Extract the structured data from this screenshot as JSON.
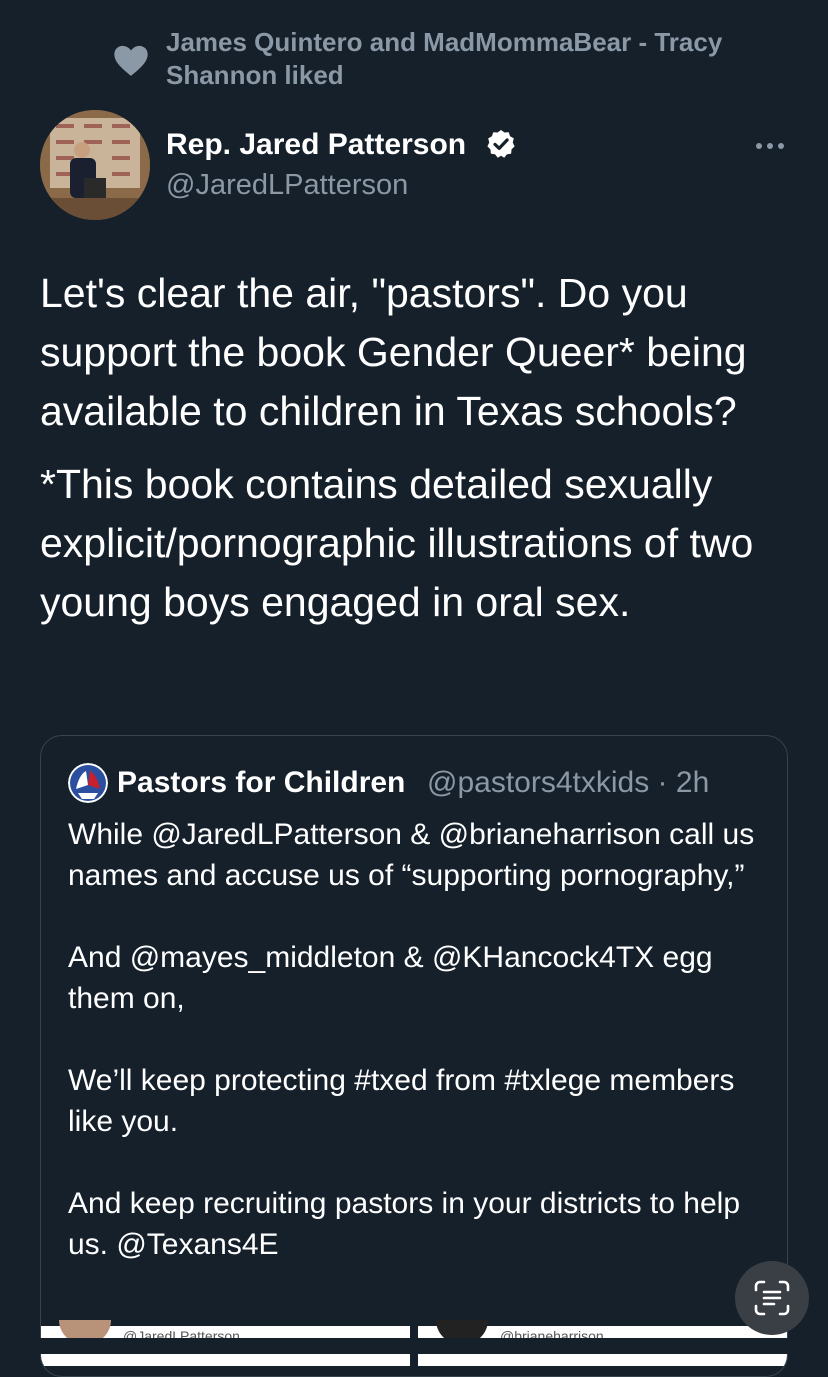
{
  "social_context": {
    "icon": "heart-icon",
    "text": "James Quintero and MadMommaBear - Tracy Shannon liked"
  },
  "tweet": {
    "author_name": "Rep. Jared Patterson",
    "author_handle": "@JaredLPatterson",
    "verified": true,
    "paragraphs": [
      "Let's clear the air, \"pastors\". Do you support the book Gender Queer* being available to children in Texas schools?",
      "*This book contains detailed sexually explicit/pornographic illustrations of two young boys engaged in oral sex."
    ]
  },
  "quote": {
    "author_name": "Pastors for Children",
    "author_handle": "@pastors4txkids",
    "separator": "·",
    "time": "2h",
    "paragraphs": [
      "While @JaredLPatterson & @brianeharrison call us names and accuse us of “supporting pornography,”",
      "And @mayes_middleton & @KHancock4TX egg them on,",
      "We’ll keep protecting #txed from  #txlege members like you.",
      "And keep recruiting pastors in your districts to help us. @Texans4E"
    ],
    "images": [
      {
        "caption": "@JaredLPatterson"
      },
      {
        "caption": "@brianeharrison"
      }
    ]
  },
  "colors": {
    "background": "#15202b",
    "secondary_text": "#8b98a5",
    "border": "#38444d",
    "verified": "#ffffff"
  }
}
